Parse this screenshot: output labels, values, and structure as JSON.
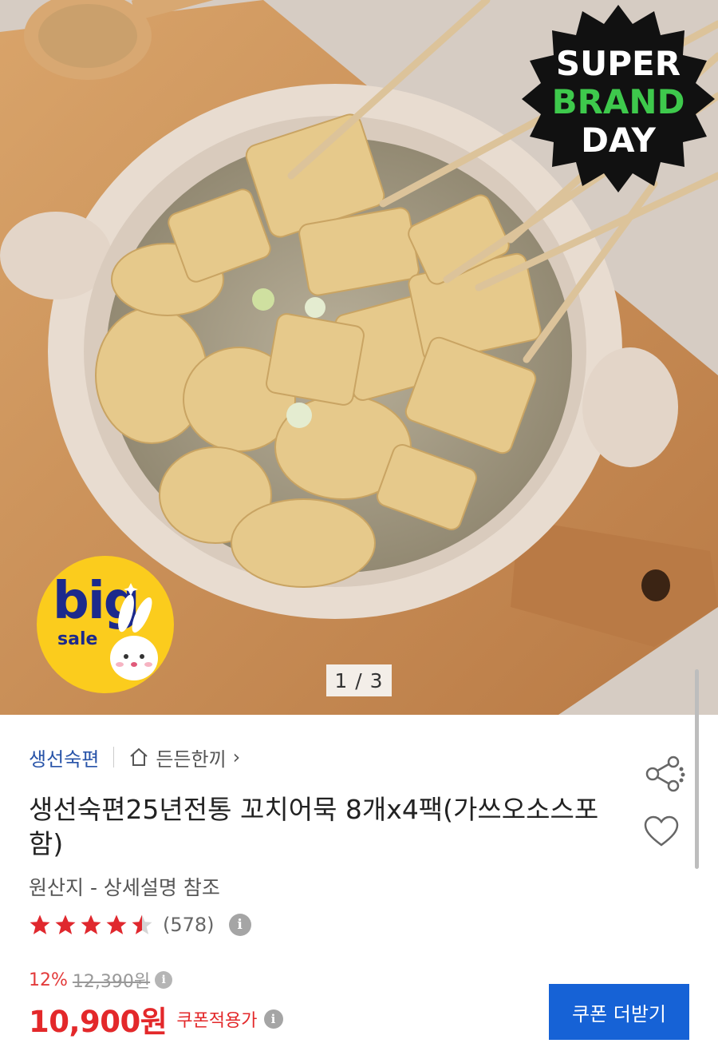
{
  "hero": {
    "image_counter": "1 / 3",
    "badge_super_brand_day": {
      "line1": "SUPER",
      "line2": "BRAND",
      "line3": "DAY"
    },
    "badge_big_sale": {
      "big": "big",
      "sale": "sale"
    }
  },
  "breadcrumb": {
    "brand": "생선숙편",
    "category": "든든한끼",
    "chevron": "›"
  },
  "product": {
    "title": "생선숙편25년전통 꼬치어묵 8개x4팩(가쓰오소스포함)",
    "origin": "원산지 - 상세설명 참조",
    "rating": {
      "value": 4.5,
      "max": 5,
      "count": "(578)"
    },
    "discount_percent": "12%",
    "original_price": "12,390원",
    "price": "10,900원",
    "coupon_label": "쿠폰적용가"
  },
  "actions": {
    "coupon_button": "쿠폰 더받기",
    "share_icon": "share-icon",
    "wishlist_icon": "heart-icon"
  },
  "colors": {
    "brand_link": "#2753a8",
    "price_red": "#e3282a",
    "button_blue": "#1662d6",
    "star_red": "#e0282e"
  }
}
